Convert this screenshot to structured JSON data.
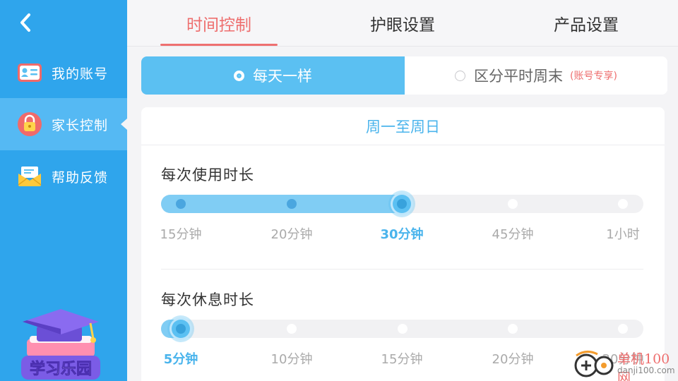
{
  "sidebar": {
    "back_icon": "chevron-left-icon",
    "items": [
      {
        "label": "我的账号",
        "icon": "id-card-icon"
      },
      {
        "label": "家长控制",
        "icon": "lock-icon",
        "active": true
      },
      {
        "label": "帮助反馈",
        "icon": "envelope-icon"
      }
    ],
    "mascot": {
      "text": "学习乐园",
      "icon": "graduation-cap-books-icon"
    }
  },
  "tabs": [
    {
      "label": "时间控制",
      "active": true
    },
    {
      "label": "护眼设置"
    },
    {
      "label": "产品设置"
    }
  ],
  "mode": {
    "options": [
      {
        "label": "每天一样",
        "selected": true
      },
      {
        "label": "区分平时周末",
        "note": "(账号专享)"
      }
    ]
  },
  "schedule": {
    "header": "周一至周日",
    "use_duration": {
      "title": "每次使用时长",
      "options": [
        "15分钟",
        "20分钟",
        "30分钟",
        "45分钟",
        "1小时"
      ],
      "selected_index": 2
    },
    "rest_duration": {
      "title": "每次休息时长",
      "options": [
        "5分钟",
        "10分钟",
        "15分钟",
        "20分钟",
        "30分钟"
      ],
      "selected_index": 0
    }
  },
  "watermark": {
    "line1": "单机100网",
    "line2": "danji100.com"
  },
  "colors": {
    "sidebar_bg": "#2fa5ec",
    "sidebar_active": "#55b9f3",
    "accent_blue": "#5bc0f2",
    "accent_red": "#ee6e6e",
    "page_bg": "#f4f4f6"
  }
}
